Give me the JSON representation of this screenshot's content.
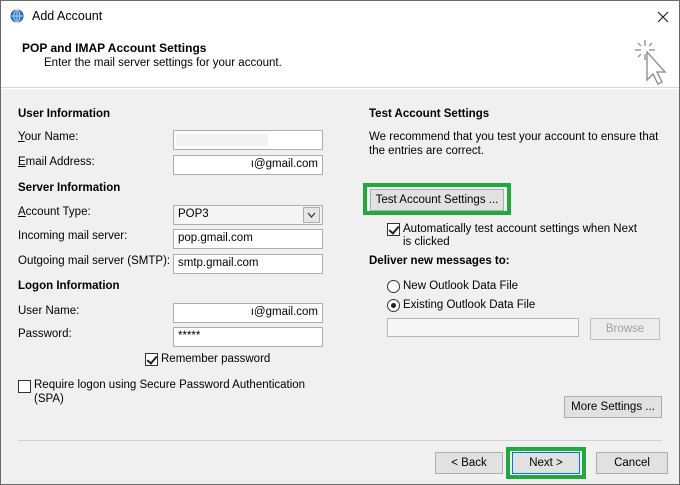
{
  "window": {
    "title": "Add Account",
    "header_title": "POP and IMAP Account Settings",
    "header_subtitle": "Enter the mail server settings for your account."
  },
  "user_info": {
    "heading": "User Information",
    "your_name_label": "Your Name:",
    "your_name_value": "",
    "email_label": "Email Address:",
    "email_value": "ı@gmail.com"
  },
  "server_info": {
    "heading": "Server Information",
    "account_type_label": "Account Type:",
    "account_type_value": "POP3",
    "incoming_label": "Incoming mail server:",
    "incoming_value": "pop.gmail.com",
    "outgoing_label": "Outgoing mail server (SMTP):",
    "outgoing_value": "smtp.gmail.com"
  },
  "logon_info": {
    "heading": "Logon Information",
    "username_label": "User Name:",
    "username_value": "ı@gmail.com",
    "password_label": "Password:",
    "password_value": "*****",
    "remember_label": "Remember password",
    "remember_checked": true,
    "spa_label_line1": "Require logon using Secure Password Authentication",
    "spa_label_line2": "(SPA)",
    "spa_checked": false
  },
  "test_settings": {
    "heading": "Test Account Settings",
    "description_line1": "We recommend that you test your account to ensure that",
    "description_line2": "the entries are correct.",
    "test_button": "Test Account Settings ...",
    "auto_test_line1": "Automatically test account settings when Next",
    "auto_test_line2": "is clicked",
    "auto_test_checked": true
  },
  "deliver": {
    "heading": "Deliver new messages to:",
    "new_file_label": "New Outlook Data File",
    "existing_file_label": "Existing Outlook Data File",
    "selected": "existing",
    "file_path_value": "",
    "browse_button": "Browse"
  },
  "buttons": {
    "more_settings": "More Settings ...",
    "back": "< Back",
    "next": "Next >",
    "cancel": "Cancel"
  },
  "colors": {
    "highlight_green": "#1eaa3c",
    "dialog_bg": "#f0f0f0"
  }
}
